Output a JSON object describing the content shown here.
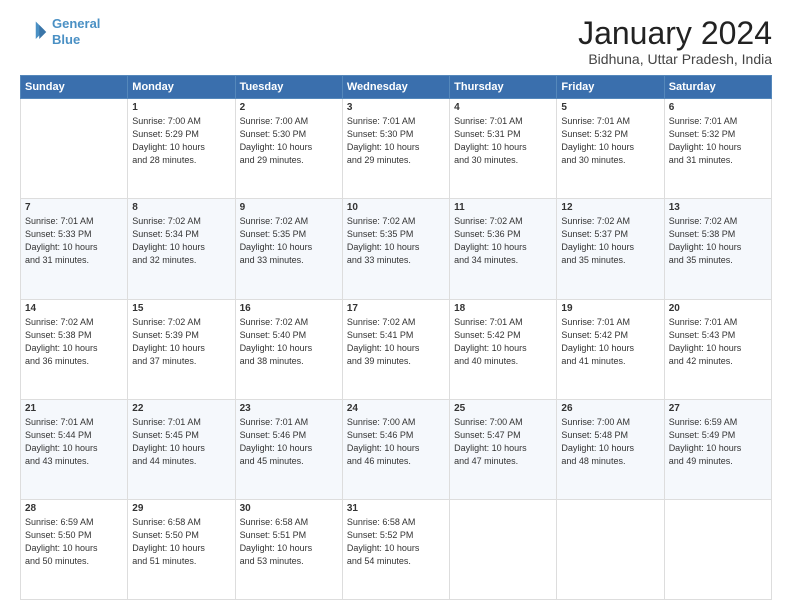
{
  "header": {
    "logo_line1": "General",
    "logo_line2": "Blue",
    "title": "January 2024",
    "location": "Bidhuna, Uttar Pradesh, India"
  },
  "calendar": {
    "days_of_week": [
      "Sunday",
      "Monday",
      "Tuesday",
      "Wednesday",
      "Thursday",
      "Friday",
      "Saturday"
    ],
    "weeks": [
      [
        {
          "day": "",
          "info": ""
        },
        {
          "day": "1",
          "info": "Sunrise: 7:00 AM\nSunset: 5:29 PM\nDaylight: 10 hours\nand 28 minutes."
        },
        {
          "day": "2",
          "info": "Sunrise: 7:00 AM\nSunset: 5:30 PM\nDaylight: 10 hours\nand 29 minutes."
        },
        {
          "day": "3",
          "info": "Sunrise: 7:01 AM\nSunset: 5:30 PM\nDaylight: 10 hours\nand 29 minutes."
        },
        {
          "day": "4",
          "info": "Sunrise: 7:01 AM\nSunset: 5:31 PM\nDaylight: 10 hours\nand 30 minutes."
        },
        {
          "day": "5",
          "info": "Sunrise: 7:01 AM\nSunset: 5:32 PM\nDaylight: 10 hours\nand 30 minutes."
        },
        {
          "day": "6",
          "info": "Sunrise: 7:01 AM\nSunset: 5:32 PM\nDaylight: 10 hours\nand 31 minutes."
        }
      ],
      [
        {
          "day": "7",
          "info": "Sunrise: 7:01 AM\nSunset: 5:33 PM\nDaylight: 10 hours\nand 31 minutes."
        },
        {
          "day": "8",
          "info": "Sunrise: 7:02 AM\nSunset: 5:34 PM\nDaylight: 10 hours\nand 32 minutes."
        },
        {
          "day": "9",
          "info": "Sunrise: 7:02 AM\nSunset: 5:35 PM\nDaylight: 10 hours\nand 33 minutes."
        },
        {
          "day": "10",
          "info": "Sunrise: 7:02 AM\nSunset: 5:35 PM\nDaylight: 10 hours\nand 33 minutes."
        },
        {
          "day": "11",
          "info": "Sunrise: 7:02 AM\nSunset: 5:36 PM\nDaylight: 10 hours\nand 34 minutes."
        },
        {
          "day": "12",
          "info": "Sunrise: 7:02 AM\nSunset: 5:37 PM\nDaylight: 10 hours\nand 35 minutes."
        },
        {
          "day": "13",
          "info": "Sunrise: 7:02 AM\nSunset: 5:38 PM\nDaylight: 10 hours\nand 35 minutes."
        }
      ],
      [
        {
          "day": "14",
          "info": "Sunrise: 7:02 AM\nSunset: 5:38 PM\nDaylight: 10 hours\nand 36 minutes."
        },
        {
          "day": "15",
          "info": "Sunrise: 7:02 AM\nSunset: 5:39 PM\nDaylight: 10 hours\nand 37 minutes."
        },
        {
          "day": "16",
          "info": "Sunrise: 7:02 AM\nSunset: 5:40 PM\nDaylight: 10 hours\nand 38 minutes."
        },
        {
          "day": "17",
          "info": "Sunrise: 7:02 AM\nSunset: 5:41 PM\nDaylight: 10 hours\nand 39 minutes."
        },
        {
          "day": "18",
          "info": "Sunrise: 7:01 AM\nSunset: 5:42 PM\nDaylight: 10 hours\nand 40 minutes."
        },
        {
          "day": "19",
          "info": "Sunrise: 7:01 AM\nSunset: 5:42 PM\nDaylight: 10 hours\nand 41 minutes."
        },
        {
          "day": "20",
          "info": "Sunrise: 7:01 AM\nSunset: 5:43 PM\nDaylight: 10 hours\nand 42 minutes."
        }
      ],
      [
        {
          "day": "21",
          "info": "Sunrise: 7:01 AM\nSunset: 5:44 PM\nDaylight: 10 hours\nand 43 minutes."
        },
        {
          "day": "22",
          "info": "Sunrise: 7:01 AM\nSunset: 5:45 PM\nDaylight: 10 hours\nand 44 minutes."
        },
        {
          "day": "23",
          "info": "Sunrise: 7:01 AM\nSunset: 5:46 PM\nDaylight: 10 hours\nand 45 minutes."
        },
        {
          "day": "24",
          "info": "Sunrise: 7:00 AM\nSunset: 5:46 PM\nDaylight: 10 hours\nand 46 minutes."
        },
        {
          "day": "25",
          "info": "Sunrise: 7:00 AM\nSunset: 5:47 PM\nDaylight: 10 hours\nand 47 minutes."
        },
        {
          "day": "26",
          "info": "Sunrise: 7:00 AM\nSunset: 5:48 PM\nDaylight: 10 hours\nand 48 minutes."
        },
        {
          "day": "27",
          "info": "Sunrise: 6:59 AM\nSunset: 5:49 PM\nDaylight: 10 hours\nand 49 minutes."
        }
      ],
      [
        {
          "day": "28",
          "info": "Sunrise: 6:59 AM\nSunset: 5:50 PM\nDaylight: 10 hours\nand 50 minutes."
        },
        {
          "day": "29",
          "info": "Sunrise: 6:58 AM\nSunset: 5:50 PM\nDaylight: 10 hours\nand 51 minutes."
        },
        {
          "day": "30",
          "info": "Sunrise: 6:58 AM\nSunset: 5:51 PM\nDaylight: 10 hours\nand 53 minutes."
        },
        {
          "day": "31",
          "info": "Sunrise: 6:58 AM\nSunset: 5:52 PM\nDaylight: 10 hours\nand 54 minutes."
        },
        {
          "day": "",
          "info": ""
        },
        {
          "day": "",
          "info": ""
        },
        {
          "day": "",
          "info": ""
        }
      ]
    ]
  }
}
